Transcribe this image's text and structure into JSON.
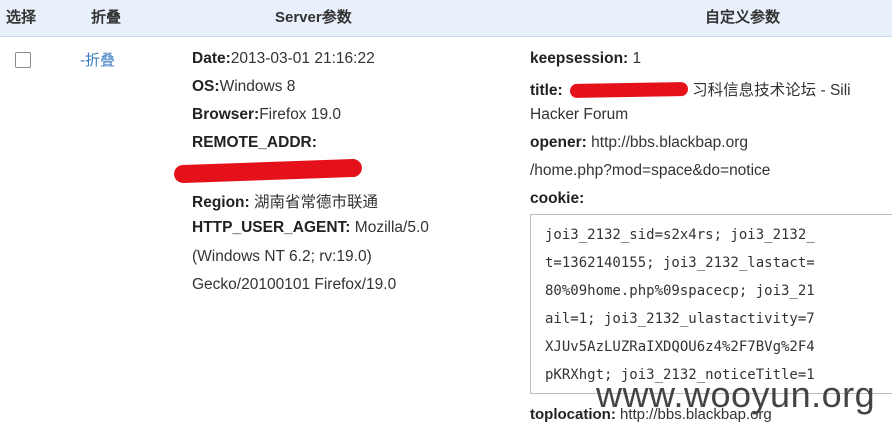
{
  "header": {
    "select": "选择",
    "fold": "折叠",
    "server": "Server参数",
    "custom": "自定义参数"
  },
  "row": {
    "fold_link": "-折叠",
    "server": {
      "date_label": "Date:",
      "date_value": "2013-03-01 21:16:22",
      "os_label": "OS:",
      "os_value": "Windows 8",
      "browser_label": "Browser:",
      "browser_value": "Firefox 19.0",
      "remote_addr_label": "REMOTE_ADDR:",
      "region_label": "Region:",
      "region_value": "湖南省常德市联通",
      "ua_label": "HTTP_USER_AGENT:",
      "ua_value_1": "Mozilla/5.0",
      "ua_value_2": "(Windows NT 6.2; rv:19.0)",
      "ua_value_3": "Gecko/20100101 Firefox/19.0"
    },
    "custom": {
      "keepsession_label": "keepsession:",
      "keepsession_value": "1",
      "title_label": "title:",
      "title_value_1": "- 习科信息技术论坛 - Sili",
      "title_value_2": "Hacker Forum",
      "opener_label": "opener:",
      "opener_value_1": "http://bbs.blackbap.org",
      "opener_value_2": "/home.php?mod=space&do=notice",
      "cookie_label": "cookie:",
      "cookie_lines": [
        "joi3_2132_sid=s2x4rs; joi3_2132_",
        "t=1362140155; joi3_2132_lastact=",
        "80%09home.php%09spacecp; joi3_21",
        "ail=1; joi3_2132_ulastactivity=7",
        "XJUv5AzLUZRaIXDQOU6z4%2F7BVg%2F4",
        "pKRXhgt; joi3_2132_noticeTitle=1"
      ],
      "toplocation_label": "toplocation:",
      "toplocation_value": "http://bbs.blackbap.org"
    }
  },
  "watermark": "www.wooyun.org",
  "colors": {
    "header_bg": "#e8f0fb",
    "link": "#3b7bbf",
    "redaction": "#e4101a"
  }
}
